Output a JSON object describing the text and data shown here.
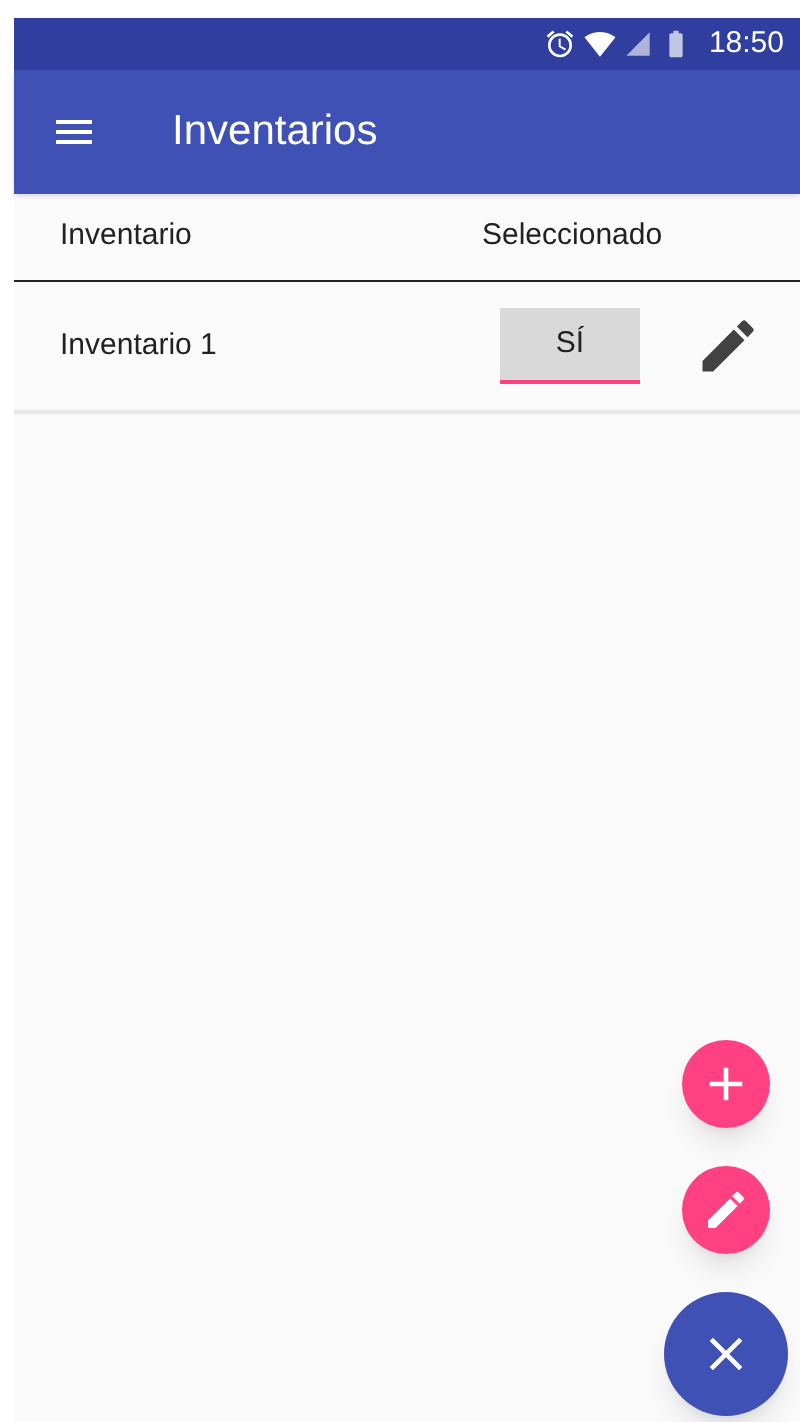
{
  "status_bar": {
    "time": "18:50"
  },
  "app_bar": {
    "title": "Inventarios"
  },
  "table": {
    "columns": [
      "Inventario",
      "Seleccionado"
    ],
    "rows": [
      {
        "name": "Inventario 1",
        "selected_value": "SÍ"
      }
    ]
  },
  "fabs": [
    {
      "kind": "add"
    },
    {
      "kind": "edit"
    },
    {
      "kind": "close"
    }
  ]
}
